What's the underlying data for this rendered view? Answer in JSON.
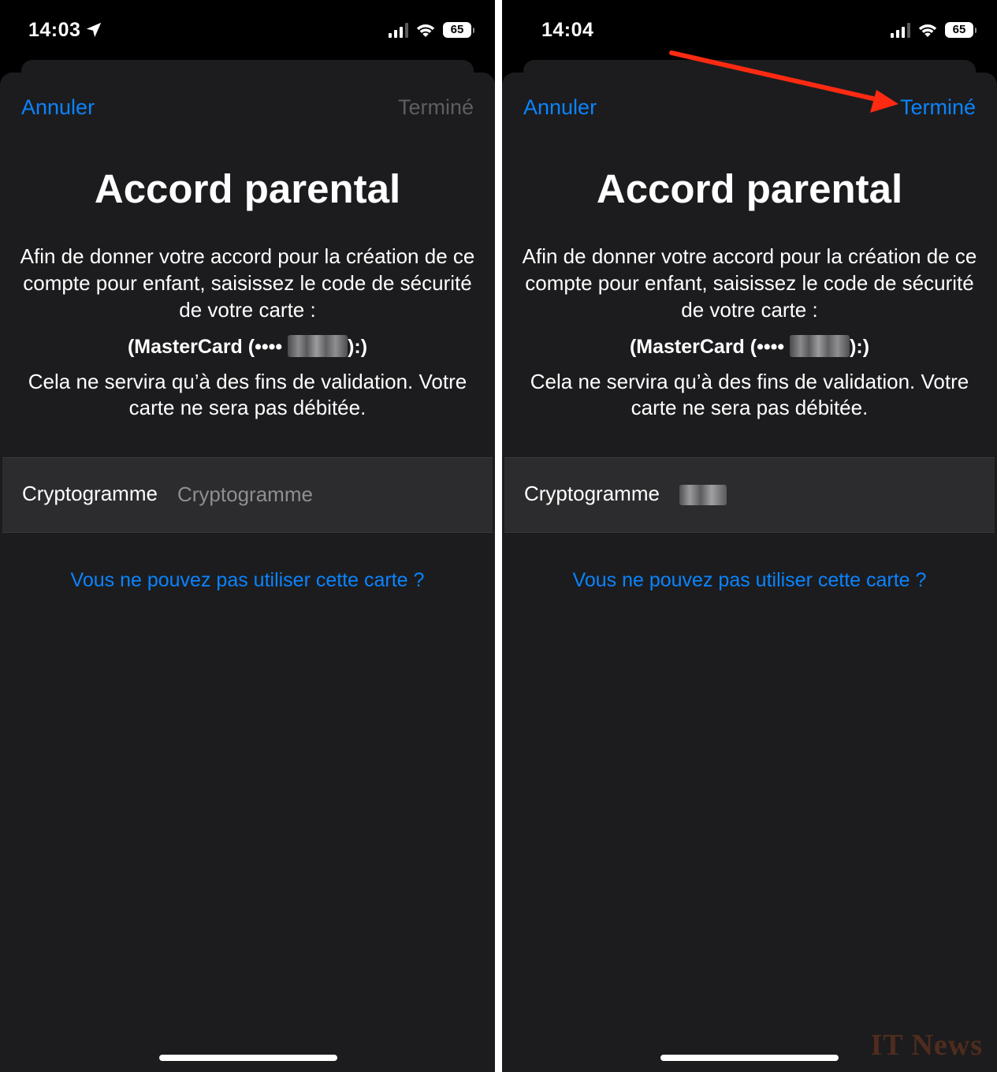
{
  "screens": [
    {
      "status_time": "14:03",
      "battery": "65",
      "cancel_label": "Annuler",
      "done_label": "Terminé",
      "title": "Accord parental",
      "description": "Afin de donner votre accord pour la création de ce compte pour enfant, saisissez le code de sécurité de votre carte :",
      "card_prefix": "(MasterCard (••••",
      "card_suffix": "):)",
      "note": "Cela ne servira qu’à des fins de validation. Votre carte ne sera pas débitée.",
      "field_label": "Cryptogramme",
      "field_placeholder": "Cryptogramme",
      "link": "Vous ne pouvez pas utiliser cette carte ?"
    },
    {
      "status_time": "14:04",
      "battery": "65",
      "cancel_label": "Annuler",
      "done_label": "Terminé",
      "title": "Accord parental",
      "description": "Afin de donner votre accord pour la création de ce compte pour enfant, saisissez le code de sécurité de votre carte :",
      "card_prefix": "(MasterCard (••••",
      "card_suffix": "):)",
      "note": "Cela ne servira qu’à des fins de validation. Votre carte ne sera pas débitée.",
      "field_label": "Cryptogramme",
      "link": "Vous ne pouvez pas utiliser cette carte ?"
    }
  ],
  "watermark": "IT News",
  "colors": {
    "accent": "#0a84ff",
    "disabled": "#5e5e62",
    "sheet": "#1c1c1e",
    "row": "#2c2c2e",
    "annotation_arrow": "#ff2a12"
  },
  "icons": [
    "location-arrow-icon",
    "cellular-signal-icon",
    "wifi-icon",
    "battery-icon",
    "annotation-arrow-icon"
  ]
}
